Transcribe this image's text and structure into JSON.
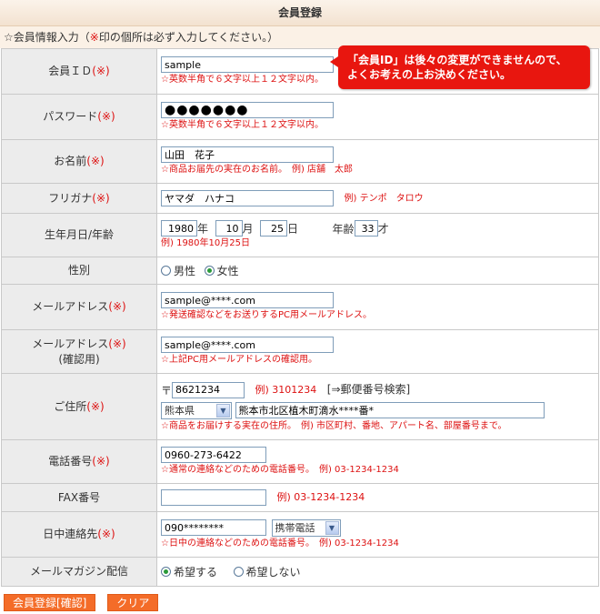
{
  "page": {
    "title": "会員登録"
  },
  "intro": {
    "prefix": "☆会員情報入力（",
    "req_mark": "※",
    "suffix": "印の個所は必ず入力してください。）"
  },
  "tooltip": {
    "line1": "「会員ID」は後々の変更ができませんので、",
    "line2": "よくお考えの上お決めください。"
  },
  "req_mark": "(※)",
  "rows": {
    "member_id": {
      "label": "会員ＩＤ",
      "value": "sample",
      "note": "☆英数半角で６文字以上１２文字以内。"
    },
    "password": {
      "label": "パスワード",
      "value": "●●●●●●●",
      "note": "☆英数半角で６文字以上１２文字以内。"
    },
    "name": {
      "label": "お名前",
      "value": "山田　花子",
      "note": "☆商品お届先の実在のお名前。　例) 店舗　太郎"
    },
    "furigana": {
      "label": "フリガナ",
      "value": "ヤマダ　ハナコ",
      "example": "例) テンポ　タロウ"
    },
    "birth": {
      "label": "生年月日/年齢",
      "year": "1980",
      "year_unit": "年",
      "month": "10",
      "month_unit": "月",
      "day": "25",
      "day_unit": "日",
      "age_label": "年齢",
      "age": "33",
      "age_unit": "才",
      "example": "例) 1980年10月25日"
    },
    "gender": {
      "label": "性別",
      "options": [
        "男性",
        "女性"
      ],
      "selected": "女性"
    },
    "email": {
      "label": "メールアドレス",
      "value": "sample@****.com",
      "note": "☆発送確認などをお送りするPC用メールアドレス。"
    },
    "email_confirm": {
      "label": "メールアドレス",
      "sublabel": "(確認用)",
      "value": "sample@****.com",
      "note": "☆上記PC用メールアドレスの確認用。"
    },
    "address": {
      "label": "ご住所",
      "postal_mark": "〒",
      "postal": "8621234",
      "postal_example": "例) 3101234",
      "postal_link": "[⇒郵便番号検索]",
      "prefecture": "熊本県",
      "street": "熊本市北区植木町滴水****番*",
      "note": "☆商品をお届けする実在の住所。　例) 市区町村、番地、アパート名、部屋番号まで。"
    },
    "phone": {
      "label": "電話番号",
      "value": "0960-273-6422",
      "note": "☆通常の連絡などのための電話番号。　例) 03-1234-1234"
    },
    "fax": {
      "label": "FAX番号",
      "value": "",
      "example": "例) 03-1234-1234"
    },
    "daytime": {
      "label": "日中連絡先",
      "value": "090********",
      "type": "携帯電話",
      "note": "☆日中の連絡などのための電話番号。　例) 03-1234-1234"
    },
    "newsletter": {
      "label": "メールマガジン配信",
      "options": [
        "希望する",
        "希望しない"
      ],
      "selected": "希望する"
    }
  },
  "buttons": {
    "submit": "会員登録[確認]",
    "clear": "クリア"
  },
  "colors": {
    "required": "#dd1111",
    "tooltip_bg": "#e8160f",
    "button_bg": "#f46c28",
    "label_bg": "#ececec"
  }
}
